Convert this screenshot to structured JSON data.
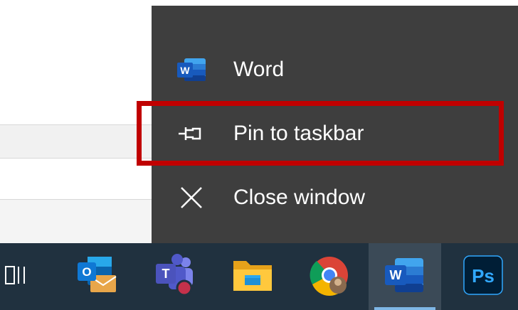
{
  "jump_list": {
    "items": [
      {
        "label": "Word",
        "icon": "word-icon"
      },
      {
        "label": "Pin to taskbar",
        "icon": "pin-icon"
      },
      {
        "label": "Close window",
        "icon": "close-icon"
      }
    ],
    "highlight_color": "#c00000"
  },
  "taskbar": {
    "apps": [
      {
        "name": "task-view",
        "icon": "task-view-icon"
      },
      {
        "name": "outlook",
        "icon": "outlook-icon",
        "letter": "O"
      },
      {
        "name": "teams",
        "icon": "teams-icon",
        "letter": "T"
      },
      {
        "name": "file-explorer",
        "icon": "folder-icon"
      },
      {
        "name": "chrome",
        "icon": "chrome-icon"
      },
      {
        "name": "word",
        "icon": "word-icon",
        "letter": "W",
        "active": true
      },
      {
        "name": "photoshop",
        "icon": "photoshop-icon",
        "letter": "Ps"
      }
    ]
  },
  "colors": {
    "jump_list_bg": "#3e3e3e",
    "taskbar_bg": "#20313f",
    "word_blue": "#185abd",
    "photoshop_bg": "#001e36",
    "photoshop_fg": "#31a8ff"
  }
}
